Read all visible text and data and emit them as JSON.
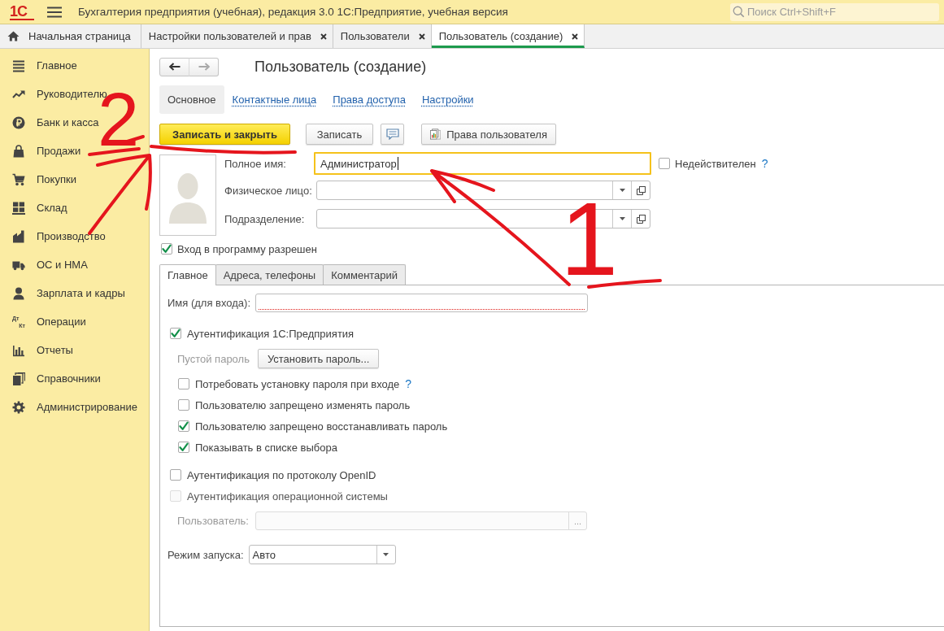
{
  "header": {
    "logo": "1С",
    "title": "Бухгалтерия предприятия (учебная), редакция 3.0 1С:Предприятие, учебная версия",
    "search": {
      "placeholder": "Поиск Ctrl+Shift+F"
    }
  },
  "open_tabs": [
    {
      "kind": "home",
      "label": "Начальная страница",
      "selected": false
    },
    {
      "kind": "page",
      "label": "Настройки пользователей и прав",
      "selected": false
    },
    {
      "kind": "page",
      "label": "Пользователи",
      "selected": false
    },
    {
      "kind": "page",
      "label": "Пользователь (создание)",
      "selected": true
    }
  ],
  "sidebar": {
    "items": [
      {
        "label": "Главное"
      },
      {
        "label": "Руководителю"
      },
      {
        "label": "Банк и касса"
      },
      {
        "label": "Продажи"
      },
      {
        "label": "Покупки"
      },
      {
        "label": "Склад"
      },
      {
        "label": "Производство"
      },
      {
        "label": "ОС и НМА"
      },
      {
        "label": "Зарплата и кадры"
      },
      {
        "label": "Операции",
        "icon_text": [
          "Дт",
          "Кт"
        ]
      },
      {
        "label": "Отчеты"
      },
      {
        "label": "Справочники"
      },
      {
        "label": "Администрирование"
      }
    ]
  },
  "form": {
    "history": [
      {
        "kind": "back",
        "disabled": false
      },
      {
        "kind": "forward",
        "disabled": true
      }
    ],
    "title": "Пользователь (создание)",
    "sections": [
      {
        "label": "Основное",
        "selected": true
      },
      {
        "label": "Контактные лица",
        "selected": false
      },
      {
        "label": "Права доступа",
        "selected": false
      },
      {
        "label": "Настройки",
        "selected": false
      }
    ],
    "commands": [
      {
        "kind": "primary",
        "label": "Записать и закрыть"
      },
      {
        "kind": "plain",
        "label": "Записать"
      },
      {
        "kind": "comment"
      },
      {
        "kind": "rights",
        "label": "Права пользователя"
      }
    ],
    "full_name": {
      "label": "Полное имя:",
      "value": "Администратор",
      "focused": true
    },
    "invalid": {
      "label": "Недействителен",
      "checked": false,
      "help": "?"
    },
    "individual": {
      "label": "Физическое лицо:"
    },
    "department": {
      "label": "Подразделение:"
    },
    "sign_in_allowed": {
      "label": "Вход в программу разрешен",
      "checked": true
    },
    "tabs": [
      {
        "label": "Главное",
        "selected": true
      },
      {
        "label": "Адреса, телефоны",
        "selected": false
      },
      {
        "label": "Комментарий",
        "selected": false
      }
    ],
    "main_page": {
      "login_name": {
        "label": "Имя (для входа):",
        "required": true
      },
      "auth_1c": {
        "label": "Аутентификация 1С:Предприятия",
        "checked": true
      },
      "password_state": "Пустой пароль",
      "set_password": "Установить пароль...",
      "password_options": [
        {
          "label": "Потребовать установку пароля при входе",
          "checked": false,
          "help": "?"
        },
        {
          "label": "Пользователю запрещено изменять пароль",
          "checked": false
        },
        {
          "label": "Пользователю запрещено восстанавливать пароль",
          "checked": true
        },
        {
          "label": "Показывать в списке выбора",
          "checked": true
        }
      ],
      "auth_openid": {
        "label": "Аутентификация по протоколу OpenID",
        "checked": false
      },
      "auth_os": {
        "label": "Аутентификация операционной системы",
        "checked": false,
        "disabled": true
      },
      "os_user": {
        "label": "Пользователь:",
        "disabled": true,
        "choice_button": "..."
      },
      "launch_mode": {
        "label": "Режим запуска:",
        "value": "Авто"
      }
    }
  },
  "annotations": [
    {
      "number": "2"
    },
    {
      "number": "1"
    }
  ]
}
